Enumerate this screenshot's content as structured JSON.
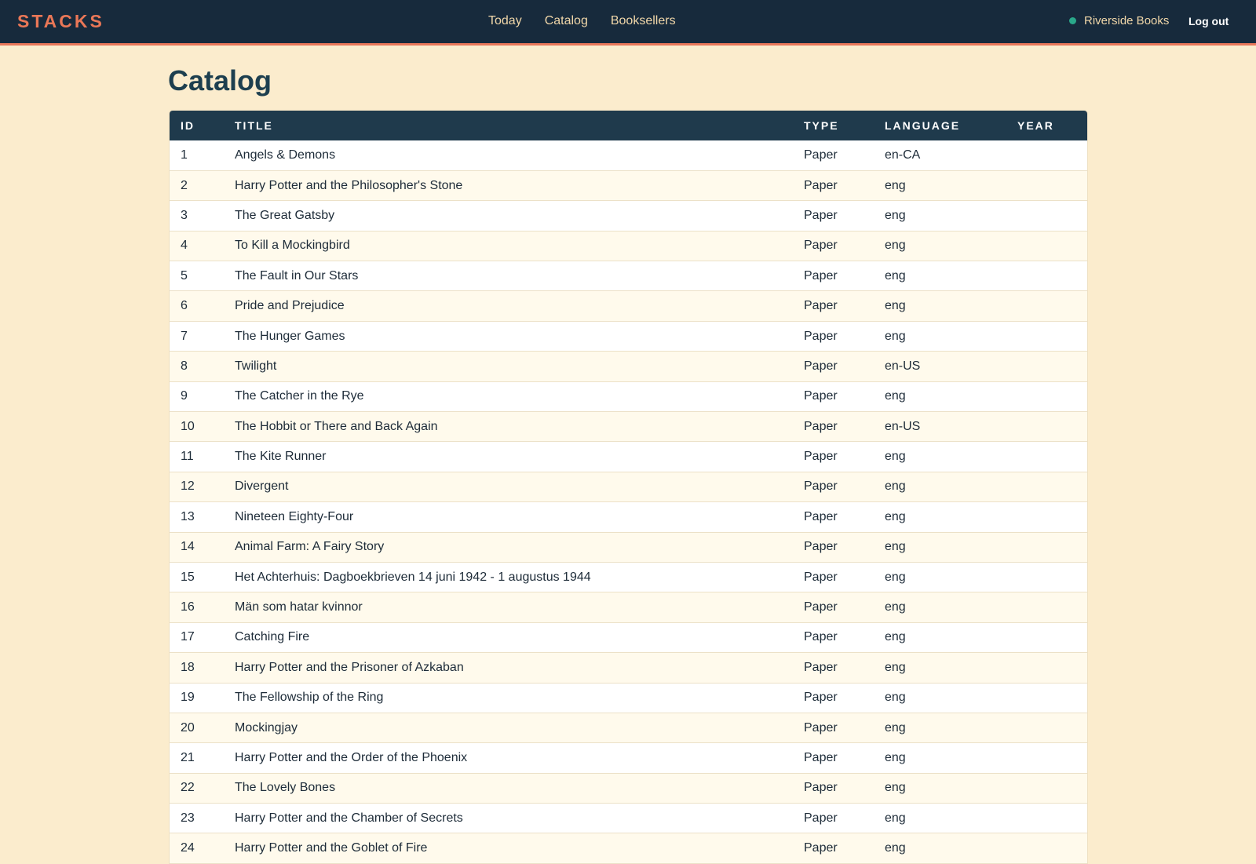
{
  "brand": "STACKS",
  "nav": [
    "Today",
    "Catalog",
    "Booksellers"
  ],
  "account": {
    "name": "Riverside Books",
    "logout": "Log out"
  },
  "page_title": "Catalog",
  "colors": {
    "topbar": "#172a3c",
    "accent": "#e8775a",
    "status": "#2aa88a",
    "background": "#fbeccd"
  },
  "table": {
    "columns": [
      "ID",
      "TITLE",
      "TYPE",
      "LANGUAGE",
      "YEAR"
    ],
    "rows": [
      [
        "1",
        "Angels & Demons",
        "Paper",
        "en-CA",
        ""
      ],
      [
        "2",
        "Harry Potter and the Philosopher's Stone",
        "Paper",
        "eng",
        ""
      ],
      [
        "3",
        "The Great Gatsby",
        "Paper",
        "eng",
        ""
      ],
      [
        "4",
        "To Kill a Mockingbird",
        "Paper",
        "eng",
        ""
      ],
      [
        "5",
        "The Fault in Our Stars",
        "Paper",
        "eng",
        ""
      ],
      [
        "6",
        "Pride and Prejudice",
        "Paper",
        "eng",
        ""
      ],
      [
        "7",
        "The Hunger Games",
        "Paper",
        "eng",
        ""
      ],
      [
        "8",
        "Twilight",
        "Paper",
        "en-US",
        ""
      ],
      [
        "9",
        "The Catcher in the Rye",
        "Paper",
        "eng",
        ""
      ],
      [
        "10",
        "The Hobbit or There and Back Again",
        "Paper",
        "en-US",
        ""
      ],
      [
        "11",
        "The Kite Runner",
        "Paper",
        "eng",
        ""
      ],
      [
        "12",
        "Divergent",
        "Paper",
        "eng",
        ""
      ],
      [
        "13",
        "Nineteen Eighty-Four",
        "Paper",
        "eng",
        ""
      ],
      [
        "14",
        "Animal Farm: A Fairy Story",
        "Paper",
        "eng",
        ""
      ],
      [
        "15",
        "Het Achterhuis: Dagboekbrieven 14 juni 1942 - 1 augustus 1944",
        "Paper",
        "eng",
        ""
      ],
      [
        "16",
        "Män som hatar kvinnor",
        "Paper",
        "eng",
        ""
      ],
      [
        "17",
        "Catching Fire",
        "Paper",
        "eng",
        ""
      ],
      [
        "18",
        "Harry Potter and the Prisoner of Azkaban",
        "Paper",
        "eng",
        ""
      ],
      [
        "19",
        "The Fellowship of the Ring",
        "Paper",
        "eng",
        ""
      ],
      [
        "20",
        "Mockingjay",
        "Paper",
        "eng",
        ""
      ],
      [
        "21",
        "Harry Potter and the Order of the Phoenix",
        "Paper",
        "eng",
        ""
      ],
      [
        "22",
        "The Lovely Bones",
        "Paper",
        "eng",
        ""
      ],
      [
        "23",
        "Harry Potter and the Chamber of Secrets",
        "Paper",
        "eng",
        ""
      ],
      [
        "24",
        "Harry Potter and the Goblet of Fire",
        "Paper",
        "eng",
        ""
      ]
    ]
  }
}
